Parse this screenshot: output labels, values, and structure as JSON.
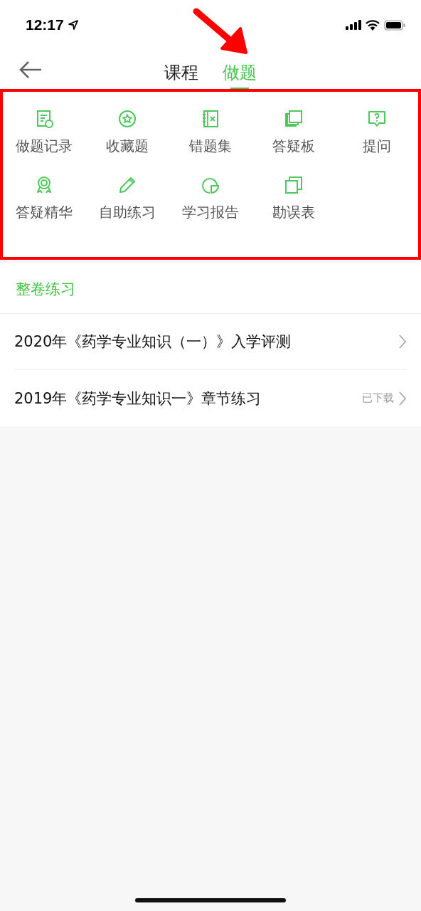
{
  "status_bar": {
    "time": "12:17"
  },
  "header": {
    "tabs": [
      {
        "label": "课程",
        "selected": false
      },
      {
        "label": "做题",
        "selected": true
      }
    ]
  },
  "tools": [
    {
      "label": "做题记录",
      "kind": "record"
    },
    {
      "label": "收藏题",
      "kind": "star"
    },
    {
      "label": "错题集",
      "kind": "wrongbook"
    },
    {
      "label": "答疑板",
      "kind": "board"
    },
    {
      "label": "提问",
      "kind": "question"
    },
    {
      "label": "答疑精华",
      "kind": "medal"
    },
    {
      "label": "自助练习",
      "kind": "pencil"
    },
    {
      "label": "学习报告",
      "kind": "chart"
    },
    {
      "label": "勘误表",
      "kind": "copies"
    }
  ],
  "section": {
    "title": "整卷练习"
  },
  "papers": [
    {
      "title": "2020年《药学专业知识（一）》入学评测"
    },
    {
      "title": "2019年《药学专业知识一》章节练习",
      "badge": "已下载"
    }
  ],
  "annotations": {
    "arrow": true,
    "frame": true
  }
}
